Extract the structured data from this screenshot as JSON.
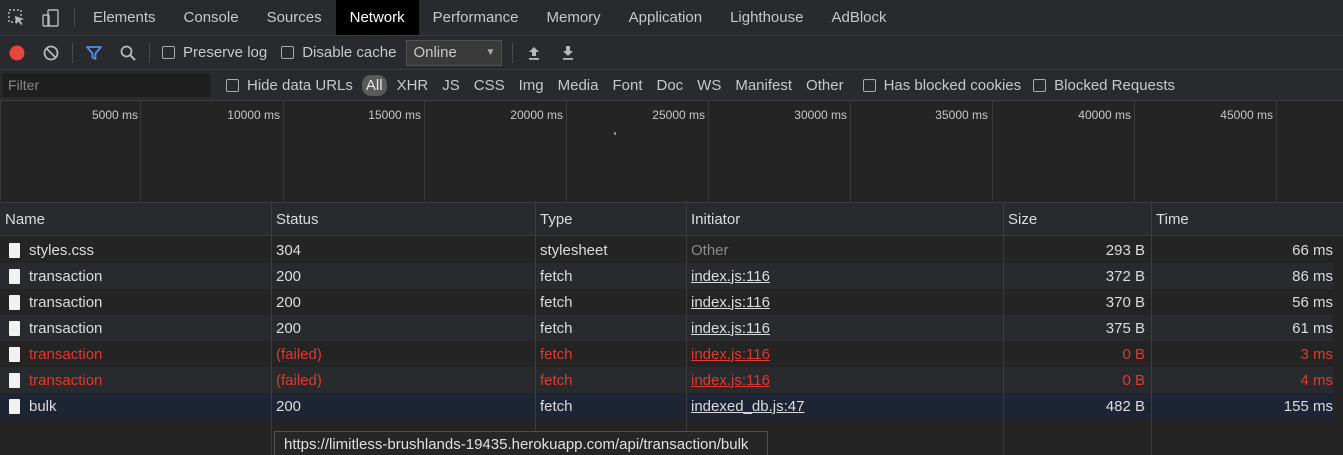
{
  "tabs": [
    {
      "label": "Elements"
    },
    {
      "label": "Console"
    },
    {
      "label": "Sources"
    },
    {
      "label": "Network",
      "active": true
    },
    {
      "label": "Performance"
    },
    {
      "label": "Memory"
    },
    {
      "label": "Application"
    },
    {
      "label": "Lighthouse"
    },
    {
      "label": "AdBlock"
    }
  ],
  "toolbar": {
    "preserve_log": "Preserve log",
    "disable_cache": "Disable cache",
    "throttling": "Online"
  },
  "filterbar": {
    "placeholder": "Filter",
    "hide_data_urls": "Hide data URLs",
    "types": [
      "All",
      "XHR",
      "JS",
      "CSS",
      "Img",
      "Media",
      "Font",
      "Doc",
      "WS",
      "Manifest",
      "Other"
    ],
    "has_blocked_cookies": "Has blocked cookies",
    "blocked_requests": "Blocked Requests"
  },
  "overview": {
    "ticks": [
      "5000 ms",
      "10000 ms",
      "15000 ms",
      "20000 ms",
      "25000 ms",
      "30000 ms",
      "35000 ms",
      "40000 ms",
      "45000 ms"
    ]
  },
  "table": {
    "columns": [
      "Name",
      "Status",
      "Type",
      "Initiator",
      "Size",
      "Time"
    ],
    "rows": [
      {
        "name": "styles.css",
        "status": "304",
        "type": "stylesheet",
        "initiator": "Other",
        "size": "293 B",
        "time": "66 ms",
        "failed": false
      },
      {
        "name": "transaction",
        "status": "200",
        "type": "fetch",
        "initiator": "index.js:116",
        "size": "372 B",
        "time": "86 ms",
        "failed": false
      },
      {
        "name": "transaction",
        "status": "200",
        "type": "fetch",
        "initiator": "index.js:116",
        "size": "370 B",
        "time": "56 ms",
        "failed": false
      },
      {
        "name": "transaction",
        "status": "200",
        "type": "fetch",
        "initiator": "index.js:116",
        "size": "375 B",
        "time": "61 ms",
        "failed": false
      },
      {
        "name": "transaction",
        "status": "(failed)",
        "type": "fetch",
        "initiator": "index.js:116",
        "size": "0 B",
        "time": "3 ms",
        "failed": true
      },
      {
        "name": "transaction",
        "status": "(failed)",
        "type": "fetch",
        "initiator": "index.js:116",
        "size": "0 B",
        "time": "4 ms",
        "failed": true
      },
      {
        "name": "bulk",
        "status": "200",
        "type": "fetch",
        "initiator": "indexed_db.js:47",
        "size": "482 B",
        "time": "155 ms",
        "failed": false
      }
    ]
  },
  "tooltip": "https://limitless-brushlands-19435.herokuapp.com/api/transaction/bulk",
  "colors": {
    "error": "#e0392f",
    "record": "#e8453c",
    "filter_active": "#4d8ff5",
    "selected_row": "#1d2433"
  }
}
